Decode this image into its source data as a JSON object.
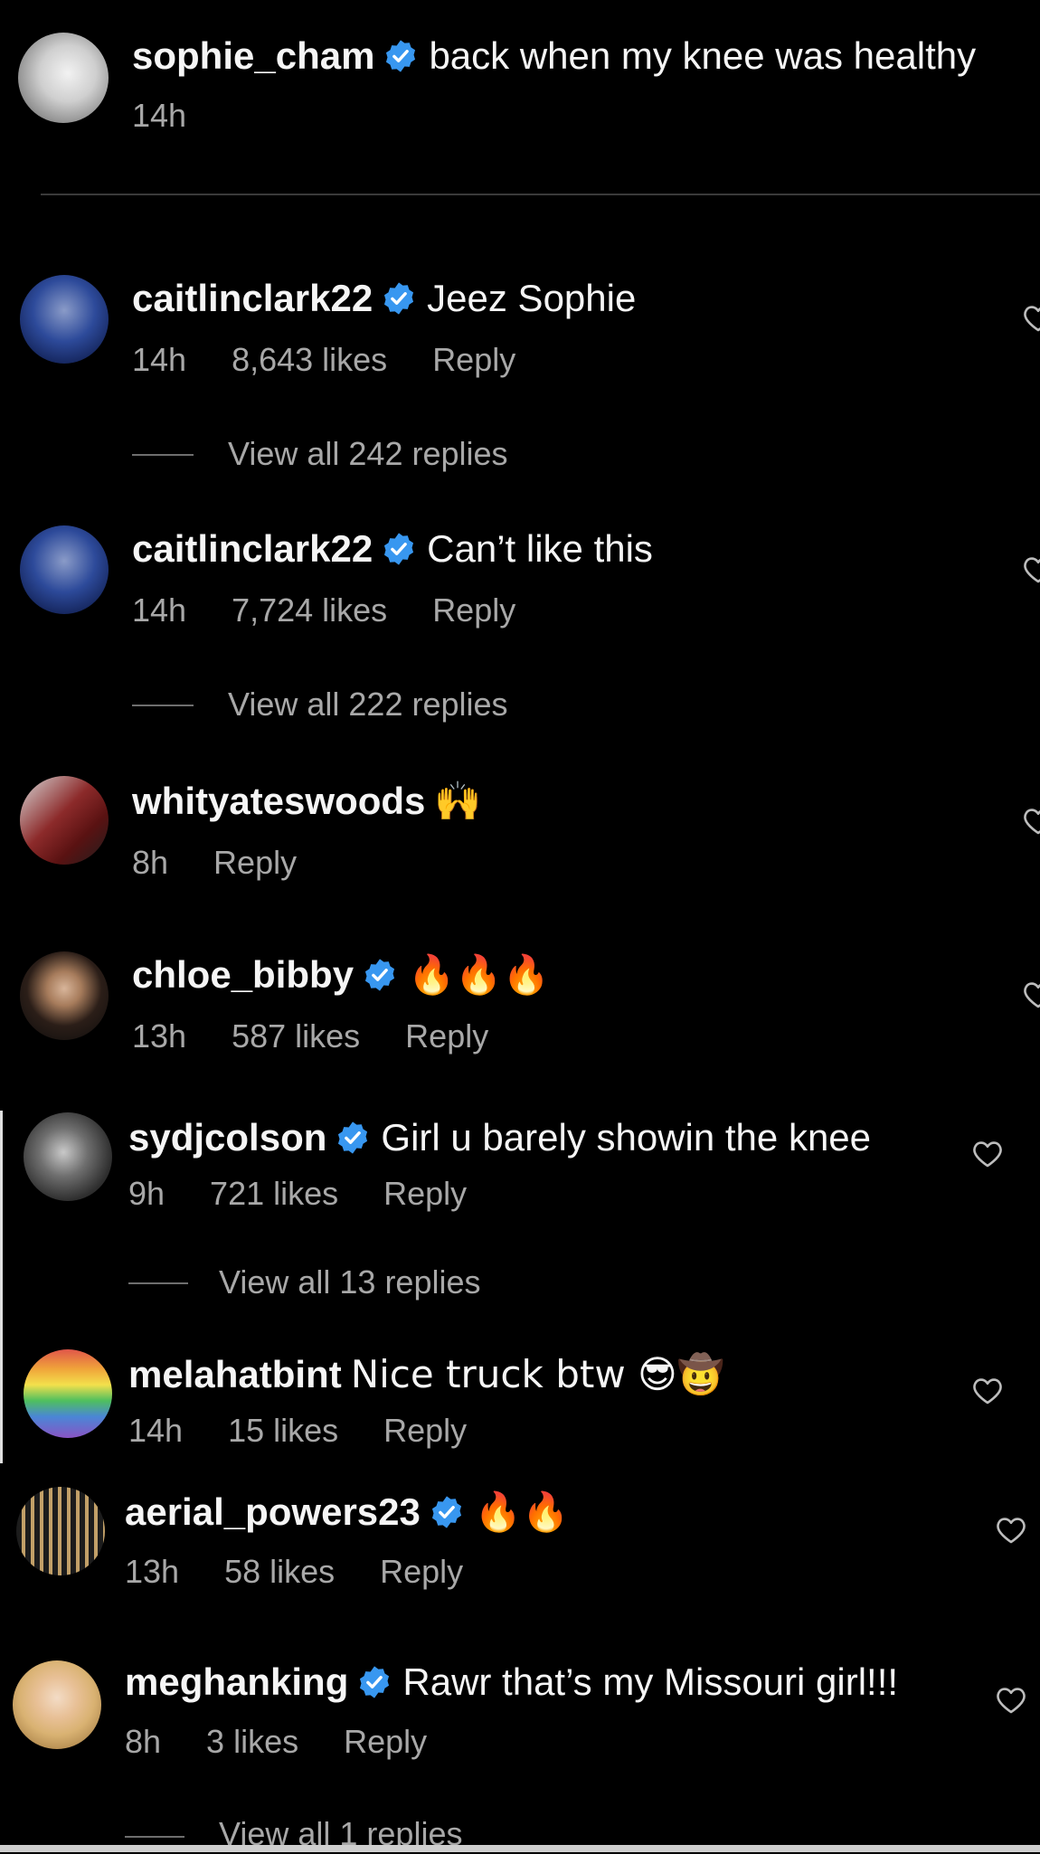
{
  "caption": {
    "username": "sophie_cham",
    "text": "back when my knee was healthy",
    "time": "14h"
  },
  "comments": [
    {
      "username": "caitlinclark22",
      "text": "Jeez Sophie",
      "time": "14h",
      "likes": "8,643 likes",
      "reply": "Reply",
      "view_replies": "View all 242 replies"
    },
    {
      "username": "caitlinclark22",
      "text": "Can’t like this",
      "time": "14h",
      "likes": "7,724 likes",
      "reply": "Reply",
      "view_replies": "View all 222 replies"
    },
    {
      "username": "whityateswoods",
      "text": "🙌",
      "time": "8h",
      "reply": "Reply"
    },
    {
      "username": "chloe_bibby",
      "text": "🔥🔥🔥",
      "time": "13h",
      "likes": "587 likes",
      "reply": "Reply"
    },
    {
      "username": "sydjcolson",
      "text": "Girl u barely showin the knee",
      "time": "9h",
      "likes": "721 likes",
      "reply": "Reply",
      "view_replies": "View all 13 replies"
    },
    {
      "username": "melahatbint",
      "text": "Nice truck btw 😎🤠",
      "time": "14h",
      "likes": "15 likes",
      "reply": "Reply"
    },
    {
      "username": "aerial_powers23",
      "text": "🔥🔥",
      "time": "13h",
      "likes": "58 likes",
      "reply": "Reply"
    },
    {
      "username": "meghanking",
      "text": "Rawr that’s my Missouri girl!!!",
      "time": "8h",
      "likes": "3 likes",
      "reply": "Reply",
      "view_replies": "View all 1 replies"
    }
  ],
  "colors": {
    "background": "#000000",
    "text_primary": "#f5f5f5",
    "text_secondary": "#a8a8a8",
    "verified_blue": "#3897f0"
  },
  "icons": {
    "verified": "verified-badge-icon",
    "like": "heart-outline-icon"
  }
}
